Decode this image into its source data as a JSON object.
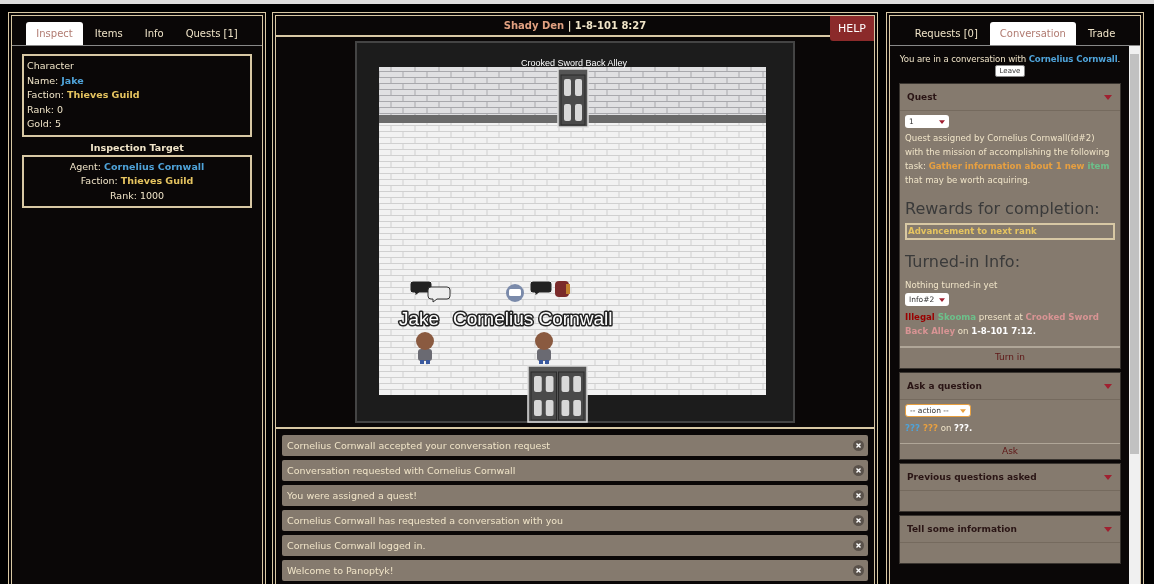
{
  "left_panel": {
    "tabs": [
      {
        "label": "Inspect",
        "selected": true
      },
      {
        "label": "Items",
        "selected": false
      },
      {
        "label": "Info",
        "selected": false
      },
      {
        "label": "Quests [1]",
        "selected": false
      }
    ],
    "character": {
      "heading": "Character",
      "fields": [
        {
          "label": "Name: ",
          "value": "Jake",
          "kind": "agent"
        },
        {
          "label": "Faction: ",
          "value": "Thieves Guild",
          "kind": "faction"
        },
        {
          "label": "Rank: ",
          "value": "0",
          "kind": "plain"
        },
        {
          "label": "Gold: ",
          "value": "5",
          "kind": "plain"
        }
      ]
    },
    "inspection_target": {
      "title": "Inspection Target",
      "fields": [
        {
          "label": "Agent: ",
          "value": "Cornelius Cornwall",
          "kind": "agent"
        },
        {
          "label": "Faction: ",
          "value": "Thieves Guild",
          "kind": "faction"
        },
        {
          "label": "Rank: ",
          "value": "1000",
          "kind": "plain"
        }
      ]
    }
  },
  "game": {
    "location": "Shady Den",
    "date": "| 1-8-101 8:27",
    "help": "HELP",
    "map_label": "Crooked Sword Back Alley",
    "players": [
      "Jake",
      "Cornelius Cornwall"
    ]
  },
  "notifications": [
    {
      "text": "Cornelius Cornwall accepted your conversation request"
    },
    {
      "text": "Conversation requested with Cornelius Cornwall"
    },
    {
      "text": "You were assigned a quest!"
    },
    {
      "text": "Cornelius Cornwall has requested a conversation with you"
    },
    {
      "text": "Cornelius Cornwall logged in."
    },
    {
      "text": "Welcome to Panoptyk!"
    }
  ],
  "right_panel": {
    "tabs": [
      {
        "label": "Requests [0]",
        "selected": false
      },
      {
        "label": "Conversation",
        "selected": true
      },
      {
        "label": "Trade",
        "selected": false
      }
    ],
    "conversation": [
      {
        "kind": "plain",
        "text": "You are in a conversation with "
      },
      {
        "kind": "agent",
        "text": "Cornelius Cornwall"
      },
      {
        "kind": "plain",
        "text": "."
      }
    ],
    "leave_button": "Leave",
    "sections": [
      {
        "kind": "quest",
        "title": "Quest",
        "select": "1",
        "description": [
          {
            "kind": "plain",
            "text": "Quest assigned by Cornelius Cornwall(id#2) with the mission of accomplishing the following task: "
          },
          {
            "kind": "task",
            "text": "Gather information about 1 new "
          },
          {
            "kind": "item",
            "text": "item"
          },
          {
            "kind": "plain",
            "text": " that may be worth acquiring."
          }
        ],
        "rewards_heading": "Rewards for completion:",
        "reward": "Advancement to next rank",
        "turned_in_heading": "Turned-in Info:",
        "turned_in_status": "Nothing turned-in yet",
        "info_select": "Info#2",
        "info": [
          {
            "kind": "illegal",
            "text": "Illegal "
          },
          {
            "kind": "item",
            "text": "Skooma"
          },
          {
            "kind": "plain",
            "text": " present at "
          },
          {
            "kind": "location",
            "text": "Crooked Sword Back Alley"
          },
          {
            "kind": "plain",
            "text": " on "
          },
          {
            "kind": "date",
            "text": "1-8-101 7:12."
          }
        ],
        "button": "Turn in"
      },
      {
        "kind": "question",
        "title": "Ask a question",
        "select": "-- action --",
        "info": [
          {
            "kind": "agent",
            "text": "??? "
          },
          {
            "kind": "task",
            "text": "???"
          },
          {
            "kind": "plain",
            "text": " on "
          },
          {
            "kind": "date",
            "text": "???."
          }
        ],
        "button": "Ask"
      },
      {
        "kind": "collapsed",
        "title": "Previous questions asked"
      },
      {
        "kind": "collapsed",
        "title": "Tell some information"
      }
    ]
  }
}
